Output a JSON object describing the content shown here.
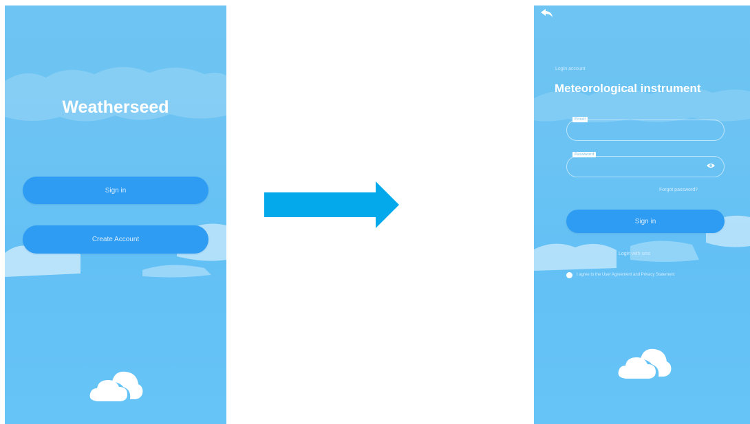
{
  "left_screen": {
    "app_title": "Weatherseed",
    "sign_in_label": "Sign in",
    "create_account_label": "Create Account"
  },
  "right_screen": {
    "subtitle": "Login account",
    "title": "Meteorological instrument",
    "account_label": "Email",
    "password_label": "Password",
    "forgot_password": "Forgot password?",
    "sign_in_label": "Sign in",
    "alt_login": "Login with sms",
    "agreement": "I agree to the User Agreement and Privacy Statement"
  },
  "colors": {
    "sky": "#6bc3f3",
    "button": "#2e9cf2",
    "arrow": "#03a9ea"
  },
  "icons": [
    "back-arrow-icon",
    "eye-icon",
    "cloud-logo-icon",
    "right-arrow-icon"
  ]
}
